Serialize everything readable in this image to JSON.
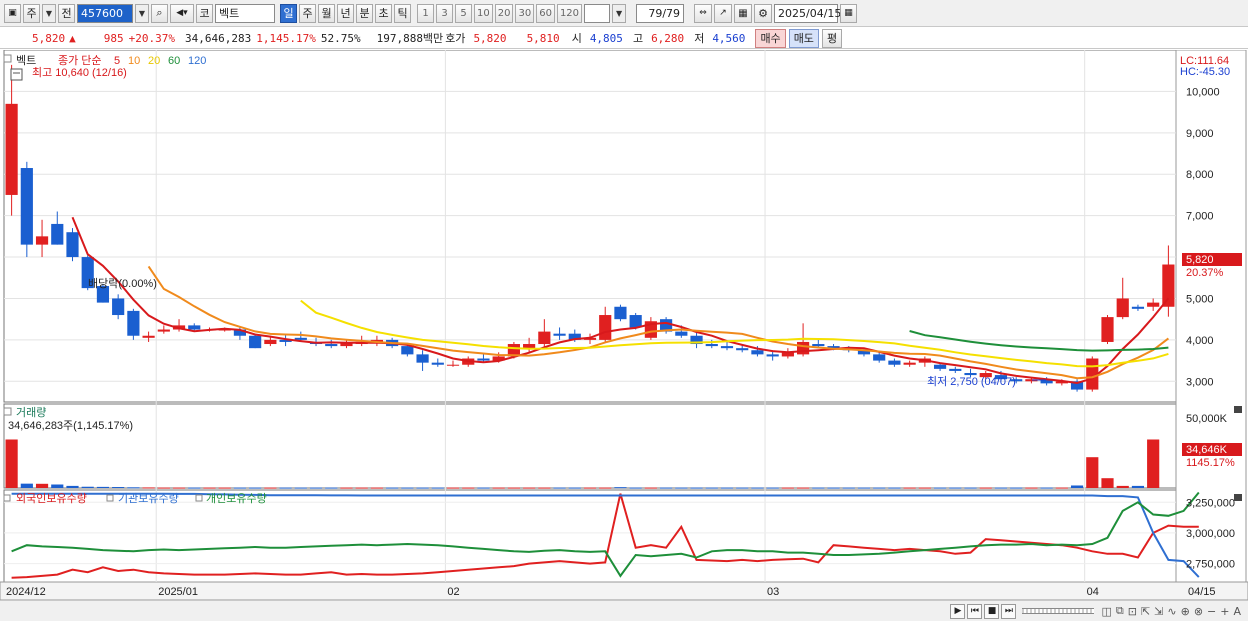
{
  "toolbar": {
    "period_type": "주",
    "prev": "전",
    "code": "457600",
    "code_type": "코",
    "stock_name": "벡트",
    "periods": [
      "일",
      "주",
      "월",
      "년",
      "분",
      "초",
      "틱"
    ],
    "active_period": "일",
    "intervals": [
      "1",
      "3",
      "5",
      "10",
      "20",
      "30",
      "60",
      "120"
    ],
    "count": "79",
    "count_total": "/79",
    "date": "2025/04/15"
  },
  "quote": {
    "price": "5,820",
    "change_icon": "▲",
    "change": "985",
    "change_pct": "+20.37%",
    "volume": "34,646,283",
    "volume_pct": "1,145.17%",
    "rate": "52.75%",
    "amount": "197,888백만",
    "hoga_label": "호가",
    "ask": "5,820",
    "bid": "5,810",
    "open_label": "시",
    "open": "4,805",
    "high_label": "고",
    "high": "6,280",
    "low_label": "저",
    "low": "4,560",
    "buy_label": "매수",
    "sell_label": "매도",
    "avg_label": "평"
  },
  "price_panel": {
    "name": "벡트",
    "ma_label": "종가 단순",
    "ma_periods": [
      "5",
      "10",
      "20",
      "60",
      "120"
    ],
    "ma_colors": [
      "#d8191c",
      "#f08a1c",
      "#f5e000",
      "#1e8f3a",
      "#2f6fd1"
    ],
    "high_note": "최고 10,640 (12/16)",
    "low_note": "최저 2,750 (04/07)",
    "dividend_note": "배당락(0.00%)",
    "lc": "LC:111.64",
    "hc": "HC:-45.30",
    "price_tag": "5,820",
    "pct_tag": "20.37%",
    "y_ticks": [
      "10,000",
      "9,000",
      "8,000",
      "7,000",
      "6,000",
      "5,000",
      "4,000",
      "3,000"
    ]
  },
  "volume_panel": {
    "title": "거래량",
    "info": "34,646,283주(1,145.17%)",
    "tick": "50,000K",
    "tag": "34,646K",
    "pct_tag": "1145.17%"
  },
  "holdings_panel": {
    "series": [
      "외국인보유수량",
      "기관보유수량",
      "개인보유수량"
    ],
    "ticks": [
      "3,250,000",
      "3,000,000",
      "2,750,000"
    ]
  },
  "x_labels": [
    "2024/12",
    "2025/01",
    "02",
    "03",
    "04",
    "04/15"
  ],
  "chart_data": {
    "type": "candlestick",
    "price_ylim": [
      2500,
      11000
    ],
    "candles": [
      {
        "o": 7500,
        "h": 10640,
        "l": 7000,
        "c": 9700
      },
      {
        "o": 8150,
        "h": 8300,
        "l": 6000,
        "c": 6300
      },
      {
        "o": 6300,
        "h": 6900,
        "l": 6000,
        "c": 6500
      },
      {
        "o": 6800,
        "h": 7100,
        "l": 6300,
        "c": 6300
      },
      {
        "o": 6600,
        "h": 6700,
        "l": 5900,
        "c": 6000
      },
      {
        "o": 6000,
        "h": 6050,
        "l": 5200,
        "c": 5250
      },
      {
        "o": 5300,
        "h": 5350,
        "l": 4900,
        "c": 4900
      },
      {
        "o": 5000,
        "h": 5100,
        "l": 4500,
        "c": 4600
      },
      {
        "o": 4700,
        "h": 4750,
        "l": 4000,
        "c": 4100
      },
      {
        "o": 4050,
        "h": 4200,
        "l": 3950,
        "c": 4100
      },
      {
        "o": 4200,
        "h": 4350,
        "l": 4150,
        "c": 4250
      },
      {
        "o": 4250,
        "h": 4500,
        "l": 4200,
        "c": 4350
      },
      {
        "o": 4350,
        "h": 4400,
        "l": 4200,
        "c": 4250
      },
      {
        "o": 4250,
        "h": 4300,
        "l": 4200,
        "c": 4250
      },
      {
        "o": 4250,
        "h": 4300,
        "l": 4200,
        "c": 4250
      },
      {
        "o": 4250,
        "h": 4300,
        "l": 4000,
        "c": 4100
      },
      {
        "o": 4100,
        "h": 4150,
        "l": 3800,
        "c": 3800
      },
      {
        "o": 3900,
        "h": 4100,
        "l": 3850,
        "c": 4000
      },
      {
        "o": 4000,
        "h": 4150,
        "l": 3850,
        "c": 3950
      },
      {
        "o": 4050,
        "h": 4200,
        "l": 3950,
        "c": 4000
      },
      {
        "o": 3950,
        "h": 4050,
        "l": 3850,
        "c": 3900
      },
      {
        "o": 3900,
        "h": 4000,
        "l": 3800,
        "c": 3850
      },
      {
        "o": 3850,
        "h": 4000,
        "l": 3800,
        "c": 3950
      },
      {
        "o": 3900,
        "h": 4100,
        "l": 3850,
        "c": 3950
      },
      {
        "o": 3950,
        "h": 4100,
        "l": 3850,
        "c": 4000
      },
      {
        "o": 4000,
        "h": 4050,
        "l": 3800,
        "c": 3850
      },
      {
        "o": 3850,
        "h": 3900,
        "l": 3600,
        "c": 3650
      },
      {
        "o": 3650,
        "h": 3750,
        "l": 3250,
        "c": 3450
      },
      {
        "o": 3450,
        "h": 3550,
        "l": 3350,
        "c": 3400
      },
      {
        "o": 3400,
        "h": 3500,
        "l": 3350,
        "c": 3400
      },
      {
        "o": 3400,
        "h": 3600,
        "l": 3350,
        "c": 3550
      },
      {
        "o": 3550,
        "h": 3650,
        "l": 3450,
        "c": 3500
      },
      {
        "o": 3500,
        "h": 3700,
        "l": 3450,
        "c": 3600
      },
      {
        "o": 3600,
        "h": 3950,
        "l": 3550,
        "c": 3900
      },
      {
        "o": 3800,
        "h": 4050,
        "l": 3700,
        "c": 3900
      },
      {
        "o": 3900,
        "h": 4500,
        "l": 3800,
        "c": 4200
      },
      {
        "o": 4150,
        "h": 4300,
        "l": 4000,
        "c": 4100
      },
      {
        "o": 4150,
        "h": 4250,
        "l": 3950,
        "c": 4000
      },
      {
        "o": 4000,
        "h": 4150,
        "l": 3900,
        "c": 4050
      },
      {
        "o": 4000,
        "h": 4800,
        "l": 3950,
        "c": 4600
      },
      {
        "o": 4800,
        "h": 4850,
        "l": 4450,
        "c": 4500
      },
      {
        "o": 4600,
        "h": 4650,
        "l": 4250,
        "c": 4300
      },
      {
        "o": 4050,
        "h": 4550,
        "l": 4000,
        "c": 4450
      },
      {
        "o": 4500,
        "h": 4550,
        "l": 4150,
        "c": 4200
      },
      {
        "o": 4200,
        "h": 4350,
        "l": 4050,
        "c": 4100
      },
      {
        "o": 4100,
        "h": 4200,
        "l": 3800,
        "c": 3900
      },
      {
        "o": 3900,
        "h": 4000,
        "l": 3800,
        "c": 3850
      },
      {
        "o": 3850,
        "h": 3950,
        "l": 3750,
        "c": 3800
      },
      {
        "o": 3800,
        "h": 3900,
        "l": 3700,
        "c": 3750
      },
      {
        "o": 3750,
        "h": 3850,
        "l": 3600,
        "c": 3650
      },
      {
        "o": 3650,
        "h": 3750,
        "l": 3500,
        "c": 3600
      },
      {
        "o": 3600,
        "h": 3800,
        "l": 3550,
        "c": 3700
      },
      {
        "o": 3650,
        "h": 4400,
        "l": 3600,
        "c": 3950
      },
      {
        "o": 3900,
        "h": 4000,
        "l": 3800,
        "c": 3850
      },
      {
        "o": 3850,
        "h": 3900,
        "l": 3750,
        "c": 3800
      },
      {
        "o": 3800,
        "h": 3850,
        "l": 3700,
        "c": 3750
      },
      {
        "o": 3750,
        "h": 3800,
        "l": 3600,
        "c": 3650
      },
      {
        "o": 3650,
        "h": 3700,
        "l": 3450,
        "c": 3500
      },
      {
        "o": 3500,
        "h": 3550,
        "l": 3350,
        "c": 3400
      },
      {
        "o": 3400,
        "h": 3500,
        "l": 3350,
        "c": 3450
      },
      {
        "o": 3450,
        "h": 3600,
        "l": 3350,
        "c": 3550
      },
      {
        "o": 3400,
        "h": 3450,
        "l": 3250,
        "c": 3300
      },
      {
        "o": 3300,
        "h": 3350,
        "l": 3200,
        "c": 3250
      },
      {
        "o": 3200,
        "h": 3300,
        "l": 3100,
        "c": 3150
      },
      {
        "o": 3100,
        "h": 3250,
        "l": 3050,
        "c": 3200
      },
      {
        "o": 3150,
        "h": 3250,
        "l": 3000,
        "c": 3050
      },
      {
        "o": 3050,
        "h": 3100,
        "l": 2950,
        "c": 3000
      },
      {
        "o": 3000,
        "h": 3100,
        "l": 2950,
        "c": 3050
      },
      {
        "o": 3050,
        "h": 3100,
        "l": 2900,
        "c": 2950
      },
      {
        "o": 2950,
        "h": 3050,
        "l": 2900,
        "c": 3000
      },
      {
        "o": 3000,
        "h": 3050,
        "l": 2750,
        "c": 2800
      },
      {
        "o": 2800,
        "h": 3600,
        "l": 2750,
        "c": 3550
      },
      {
        "o": 3950,
        "h": 4600,
        "l": 3900,
        "c": 4550
      },
      {
        "o": 4550,
        "h": 5500,
        "l": 4500,
        "c": 5000
      },
      {
        "o": 4800,
        "h": 4850,
        "l": 4700,
        "c": 4750
      },
      {
        "o": 4800,
        "h": 5000,
        "l": 4700,
        "c": 4900
      },
      {
        "o": 4800,
        "h": 6280,
        "l": 4560,
        "c": 5820
      }
    ],
    "volume_max": 60000,
    "volume_k": [
      34646,
      3100,
      3000,
      2500,
      1500,
      900,
      800,
      700,
      500,
      400,
      300,
      300,
      300,
      300,
      300,
      300,
      300,
      300,
      300,
      300,
      300,
      300,
      300,
      300,
      300,
      300,
      300,
      300,
      300,
      300,
      300,
      300,
      300,
      300,
      300,
      300,
      300,
      300,
      300,
      300,
      600,
      300,
      300,
      300,
      300,
      300,
      300,
      300,
      300,
      300,
      300,
      300,
      300,
      300,
      300,
      300,
      300,
      300,
      300,
      300,
      300,
      300,
      300,
      300,
      300,
      300,
      300,
      300,
      300,
      300,
      1800,
      22000,
      7000,
      1500,
      1500,
      34646
    ],
    "holdings": {
      "ylim": [
        2600000,
        3350000
      ],
      "foreign": [
        2635000,
        2640000,
        2650000,
        2660000,
        2700000,
        2680000,
        2720000,
        2690000,
        2700000,
        2680000,
        2670000,
        2665000,
        2660000,
        2660000,
        2660000,
        2665000,
        2670000,
        2665000,
        2660000,
        2660000,
        2670000,
        2680000,
        2660000,
        2665000,
        2660000,
        2660000,
        2665000,
        2670000,
        2680000,
        2690000,
        2700000,
        2710000,
        2720000,
        2730000,
        2750000,
        2760000,
        2770000,
        2760000,
        2750000,
        2760000,
        3320000,
        2880000,
        2900000,
        2880000,
        3050000,
        2780000,
        2775000,
        2770000,
        2780000,
        2770000,
        2780000,
        2785000,
        2790000,
        2760000,
        2900000,
        2890000,
        2880000,
        2870000,
        2860000,
        2870000,
        2860000,
        2850000,
        2830000,
        2840000,
        2950000,
        2940000,
        2930000,
        2920000,
        2910000,
        2900000,
        2880000,
        2850000,
        2830000,
        2830000,
        2800000,
        3000000,
        3060000,
        3050000,
        3050000
      ],
      "institution": [
        3320000,
        3320000,
        3320000,
        3320000,
        3320000,
        3320000,
        3320000,
        3320000,
        3320000,
        3320000,
        3320000,
        3318000,
        3318000,
        3316000,
        3314000,
        3312000,
        3310000,
        3308000,
        3308000,
        3307000,
        3307000,
        3306000,
        3306000,
        3305000,
        3305000,
        3305000,
        3305000,
        3305000,
        3305000,
        3305000,
        3305000,
        3305000,
        3305000,
        3305000,
        3305000,
        3305000,
        3305000,
        3305000,
        3305000,
        3305000,
        3305000,
        3305000,
        3305000,
        3305000,
        3305000,
        3305000,
        3305000,
        3305000,
        3305000,
        3305000,
        3305000,
        3305000,
        3305000,
        3305000,
        3305000,
        3305000,
        3305000,
        3305000,
        3305000,
        3305000,
        3305000,
        3305000,
        3305000,
        3305000,
        3305000,
        3305000,
        3305000,
        3305000,
        3305000,
        3305000,
        3305000,
        3305000,
        3300000,
        3300000,
        3290000,
        3000000,
        2780000,
        2770000,
        2640000
      ],
      "individual": [
        2850000,
        2900000,
        2890000,
        2885000,
        2880000,
        2870000,
        2860000,
        2855000,
        2850000,
        2860000,
        2865000,
        2860000,
        2865000,
        2870000,
        2875000,
        2880000,
        2885000,
        2880000,
        2880000,
        2885000,
        2890000,
        2895000,
        2900000,
        2905000,
        2900000,
        2905000,
        2910000,
        2905000,
        2900000,
        2890000,
        2880000,
        2870000,
        2860000,
        2850000,
        2845000,
        2855000,
        2860000,
        2850000,
        2845000,
        2850000,
        2650000,
        2820000,
        2810000,
        2820000,
        2830000,
        2800000,
        2850000,
        2860000,
        2860000,
        2850000,
        2850000,
        2840000,
        2840000,
        2830000,
        2820000,
        2820000,
        2825000,
        2830000,
        2840000,
        2850000,
        2860000,
        2870000,
        2880000,
        2890000,
        2900000,
        2905000,
        2905000,
        2910000,
        2900000,
        2905000,
        2900000,
        2910000,
        2960000,
        3180000,
        3250000,
        3150000,
        3140000,
        3180000,
        3330000
      ]
    }
  }
}
